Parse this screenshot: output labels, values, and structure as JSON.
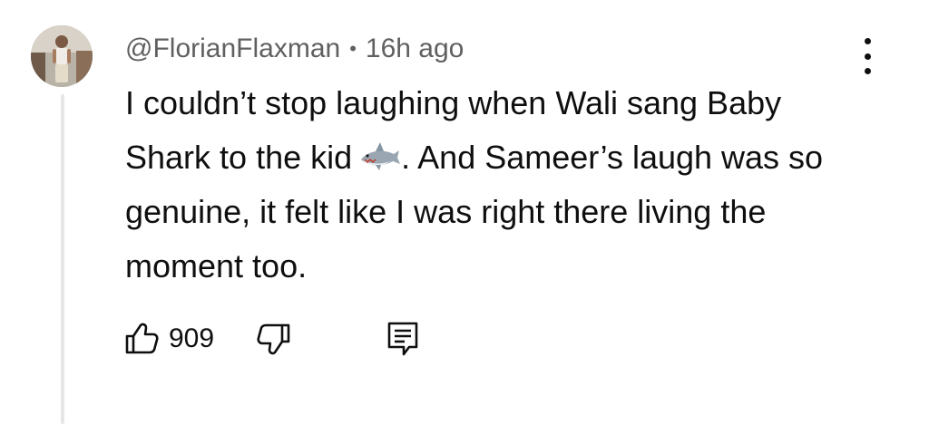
{
  "comment": {
    "author": "@FlorianFlaxman",
    "separator": "•",
    "timestamp": "16h ago",
    "text_part1": "I couldn’t stop laughing when Wali sang Baby Shark to the kid",
    "emoji": "shark",
    "text_part2": ". And Sameer’s laugh was so genuine, it felt like I was right there living the moment too.",
    "like_count": "909"
  },
  "icons": {
    "menu": "more-vertical-icon",
    "like": "thumbs-up-icon",
    "dislike": "thumbs-down-icon",
    "reply": "reply-comment-icon"
  }
}
